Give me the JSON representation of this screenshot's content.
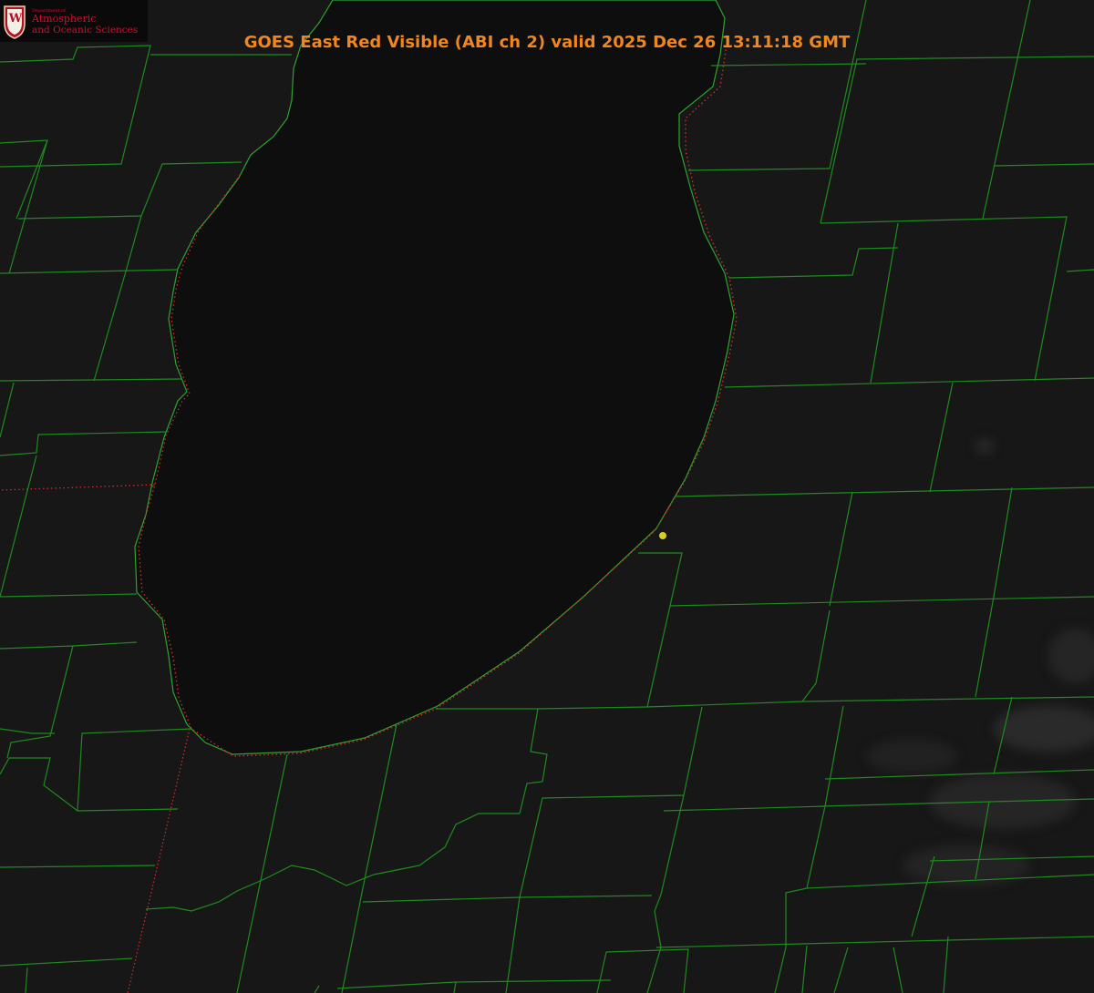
{
  "title": "GOES East Red Visible (ABI ch 2) valid 2025 Dec 26 13:11:18 GMT",
  "logo": {
    "department": "Department of",
    "line1": "Atmospheric",
    "line2": "and Oceanic Sciences",
    "letter": "W"
  },
  "colors": {
    "background": "#151515",
    "county_lines": "#1f8a1f",
    "lake_outline": "#2fa32f",
    "state_border_dotted": "#d42a2a",
    "title": "#f0861e",
    "logo_red": "#d0102d",
    "marker": "#d6cf22"
  },
  "icons": [
    "uw-crest-icon",
    "station-marker-icon"
  ]
}
